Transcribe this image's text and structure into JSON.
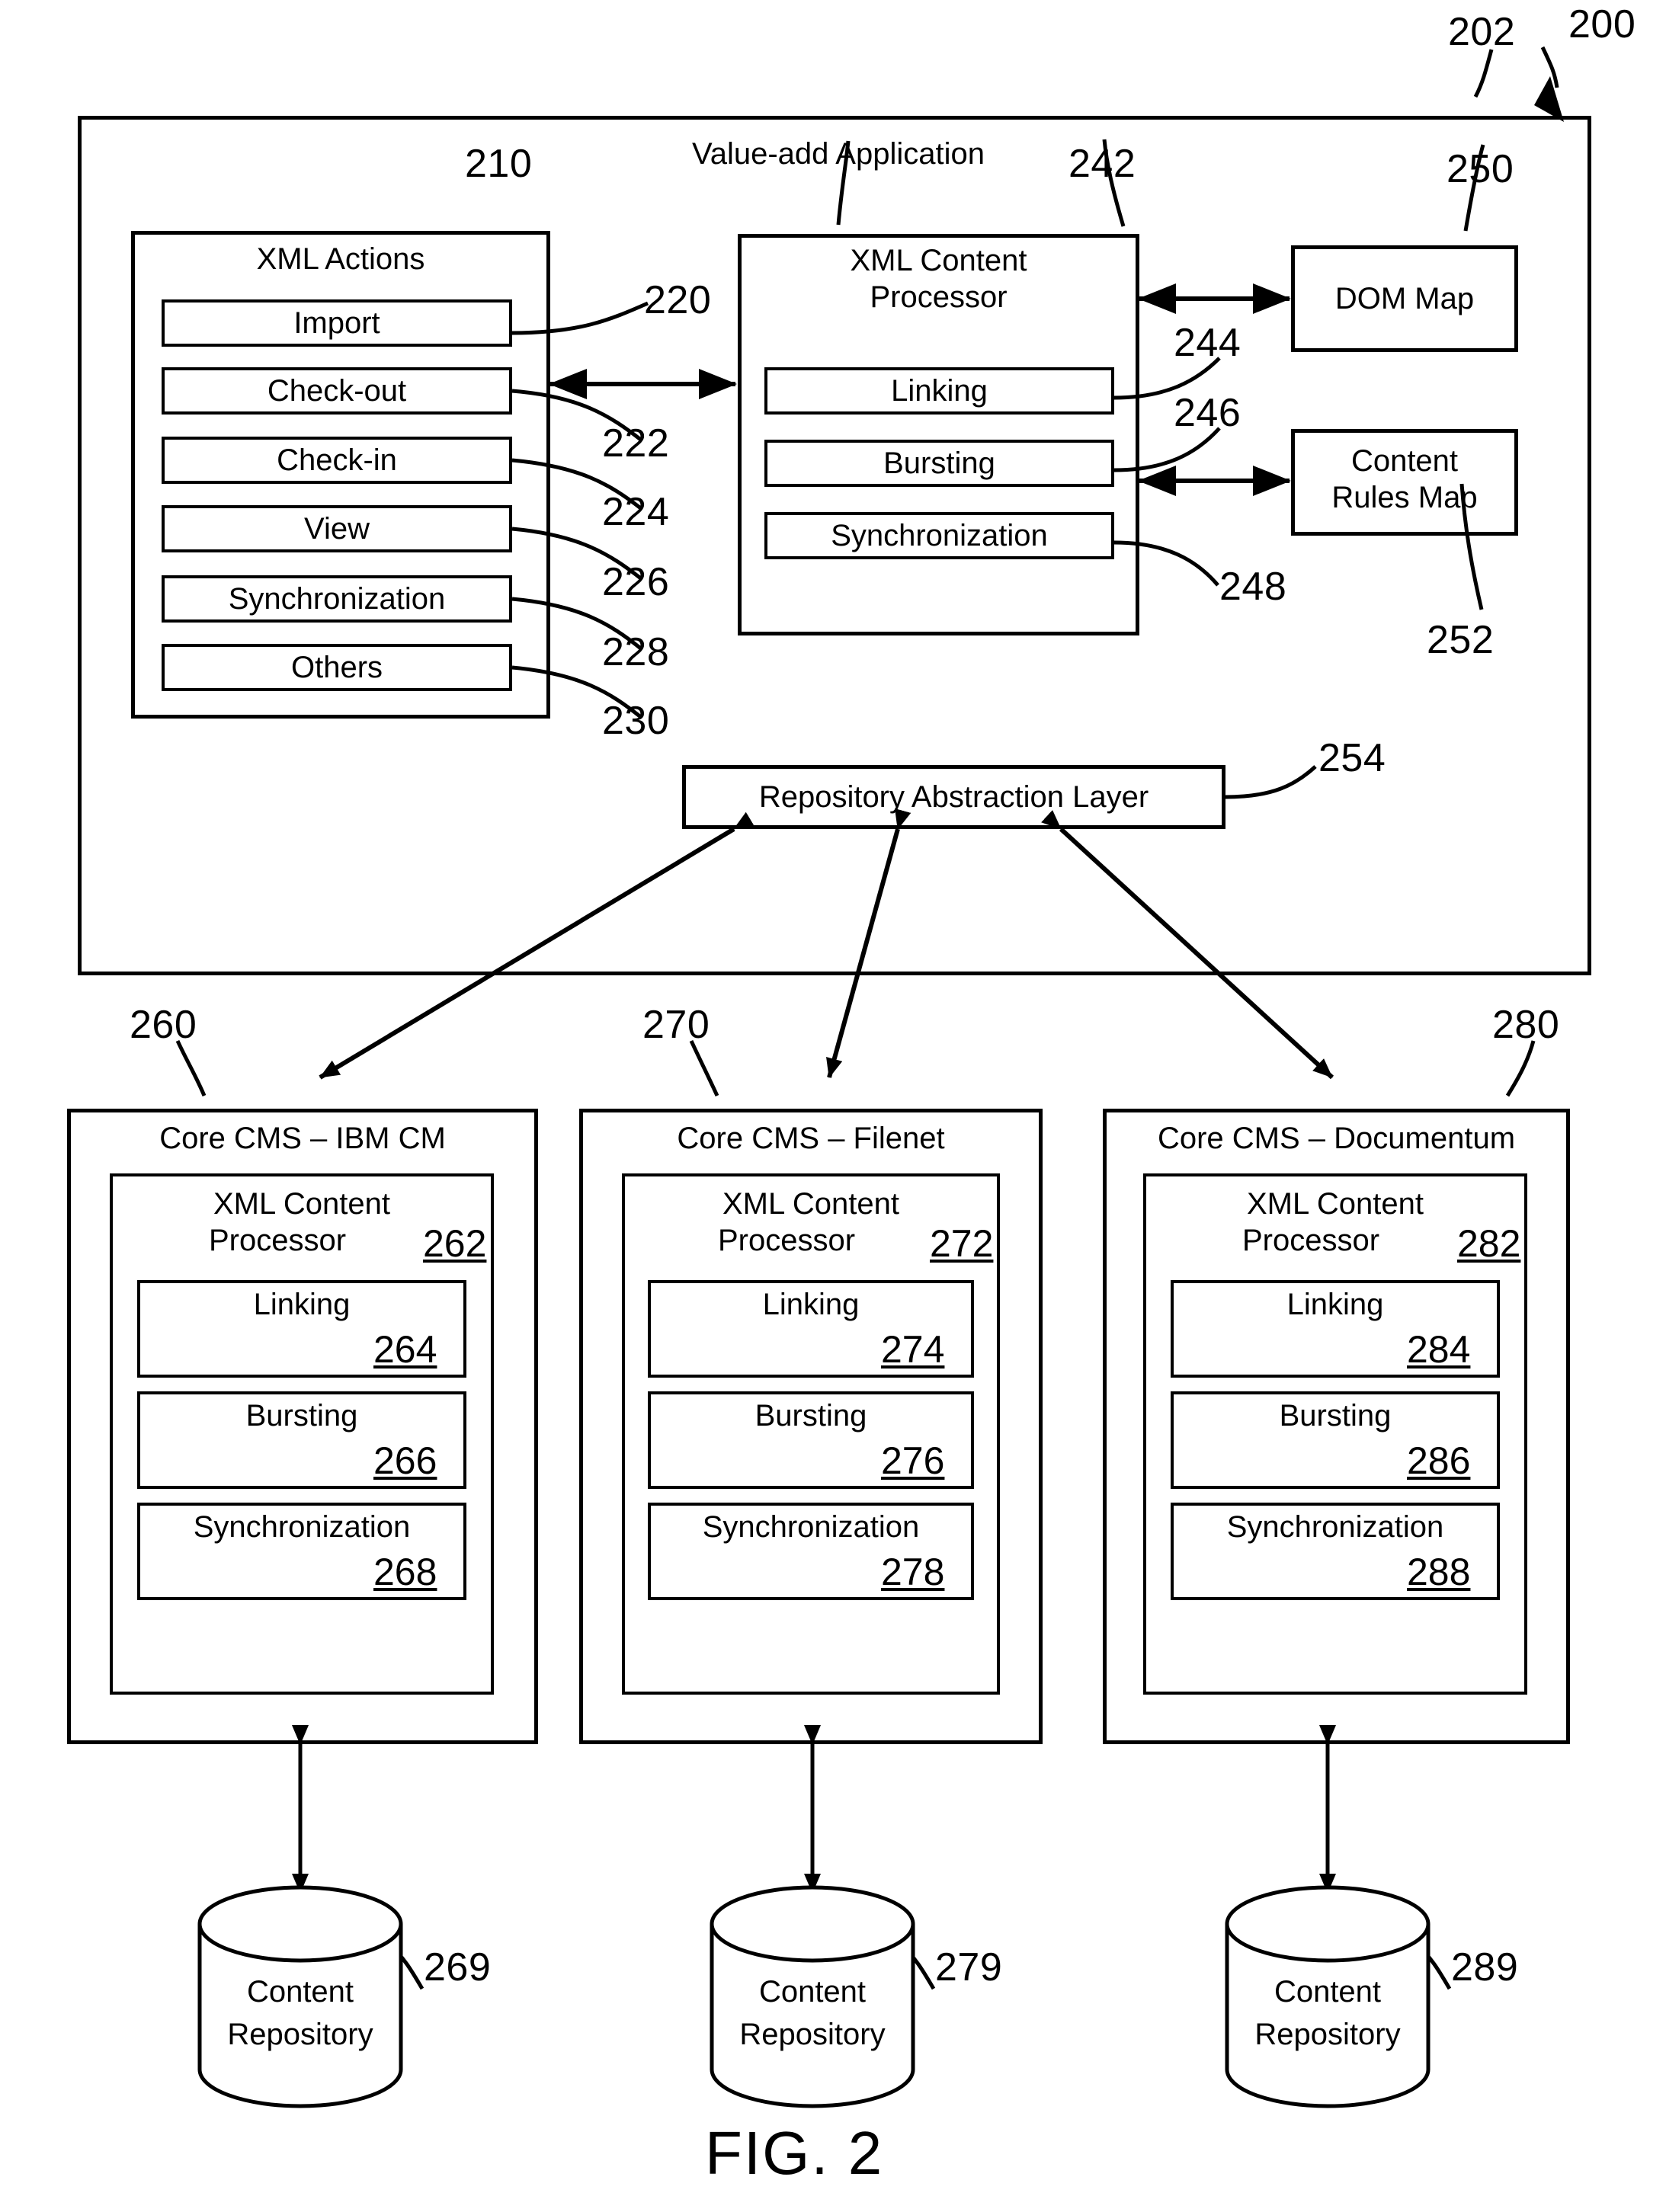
{
  "figure": {
    "caption": "FIG. 2",
    "overall_ref": "200",
    "outer_box_ref": "202",
    "outer_box_title": "Value-add Application"
  },
  "xml_actions": {
    "title": "XML Actions",
    "ref": "210",
    "items": [
      {
        "label": "Import",
        "ref": "220"
      },
      {
        "label": "Check-out",
        "ref": "222"
      },
      {
        "label": "Check-in",
        "ref": "224"
      },
      {
        "label": "View",
        "ref": "226"
      },
      {
        "label": "Synchronization",
        "ref": "228"
      },
      {
        "label": "Others",
        "ref": "230"
      }
    ]
  },
  "xml_content_processor": {
    "title_line1": "XML Content",
    "title_line2": "Processor",
    "ref": "242",
    "items": [
      {
        "label": "Linking",
        "ref": "244"
      },
      {
        "label": "Bursting",
        "ref": "246"
      },
      {
        "label": "Synchronization",
        "ref": "248"
      }
    ]
  },
  "dom_map": {
    "label": "DOM Map",
    "ref": "250"
  },
  "content_rules_map": {
    "label_line1": "Content",
    "label_line2": "Rules Map",
    "ref": "252"
  },
  "repository_abstraction_layer": {
    "label": "Repository Abstraction Layer",
    "ref": "254"
  },
  "cms": [
    {
      "title": "Core CMS – IBM CM",
      "ref": "260",
      "processor_line1": "XML Content",
      "processor_line2": "Processor",
      "processor_ref": "262",
      "modules": [
        {
          "label": "Linking",
          "ref": "264"
        },
        {
          "label": "Bursting",
          "ref": "266"
        },
        {
          "label": "Synchronization",
          "ref": "268"
        }
      ],
      "repository_line1": "Content",
      "repository_line2": "Repository",
      "repository_ref": "269"
    },
    {
      "title": "Core CMS – Filenet",
      "ref": "270",
      "processor_line1": "XML Content",
      "processor_line2": "Processor",
      "processor_ref": "272",
      "modules": [
        {
          "label": "Linking",
          "ref": "274"
        },
        {
          "label": "Bursting",
          "ref": "276"
        },
        {
          "label": "Synchronization",
          "ref": "278"
        }
      ],
      "repository_line1": "Content",
      "repository_line2": "Repository",
      "repository_ref": "279"
    },
    {
      "title": "Core CMS – Documentum",
      "ref": "280",
      "processor_line1": "XML Content",
      "processor_line2": "Processor",
      "processor_ref": "282",
      "modules": [
        {
          "label": "Linking",
          "ref": "284"
        },
        {
          "label": "Bursting",
          "ref": "286"
        },
        {
          "label": "Synchronization",
          "ref": "288"
        }
      ],
      "repository_line1": "Content",
      "repository_line2": "Repository",
      "repository_ref": "289"
    }
  ]
}
